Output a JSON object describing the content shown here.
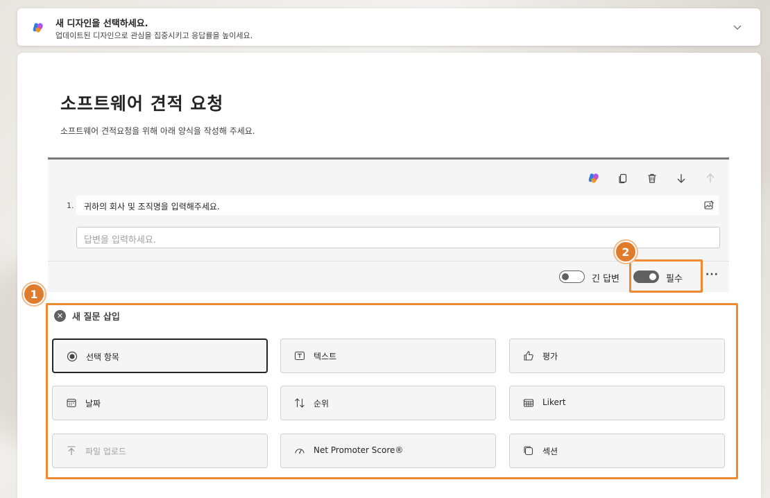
{
  "banner": {
    "title": "새 디자인을 선택하세요.",
    "subtitle": "업데이트된 디자인으로 관심을 집중시키고 응답률을 높이세요."
  },
  "form": {
    "title": "소프트웨어 견적 요청",
    "description": "소프트웨어 견적요청을 위해 아래 양식을 작성해 주세요."
  },
  "question": {
    "number": "1.",
    "text": "귀하의 회사 및 조직명을 입력해주세요.",
    "answer_placeholder": "답변을 입력하세요.",
    "long_answer_label": "긴 답변",
    "long_answer_on": false,
    "required_label": "필수",
    "required_on": true,
    "more_label": "···"
  },
  "callouts": {
    "badge1": "1",
    "badge2": "2",
    "color": "#f08a32"
  },
  "insert_panel": {
    "title": "새 질문 삽입",
    "options": [
      {
        "label": "선택 항목",
        "icon": "radio-icon"
      },
      {
        "label": "텍스트",
        "icon": "text-icon"
      },
      {
        "label": "평가",
        "icon": "thumb-icon"
      },
      {
        "label": "날짜",
        "icon": "calendar-icon"
      },
      {
        "label": "순위",
        "icon": "ranking-icon"
      },
      {
        "label": "Likert",
        "icon": "likert-icon"
      },
      {
        "label": "파일 업로드",
        "icon": "upload-icon",
        "disabled": true
      },
      {
        "label": "Net Promoter Score®",
        "icon": "gauge-icon"
      },
      {
        "label": "섹션",
        "icon": "section-icon"
      }
    ]
  }
}
